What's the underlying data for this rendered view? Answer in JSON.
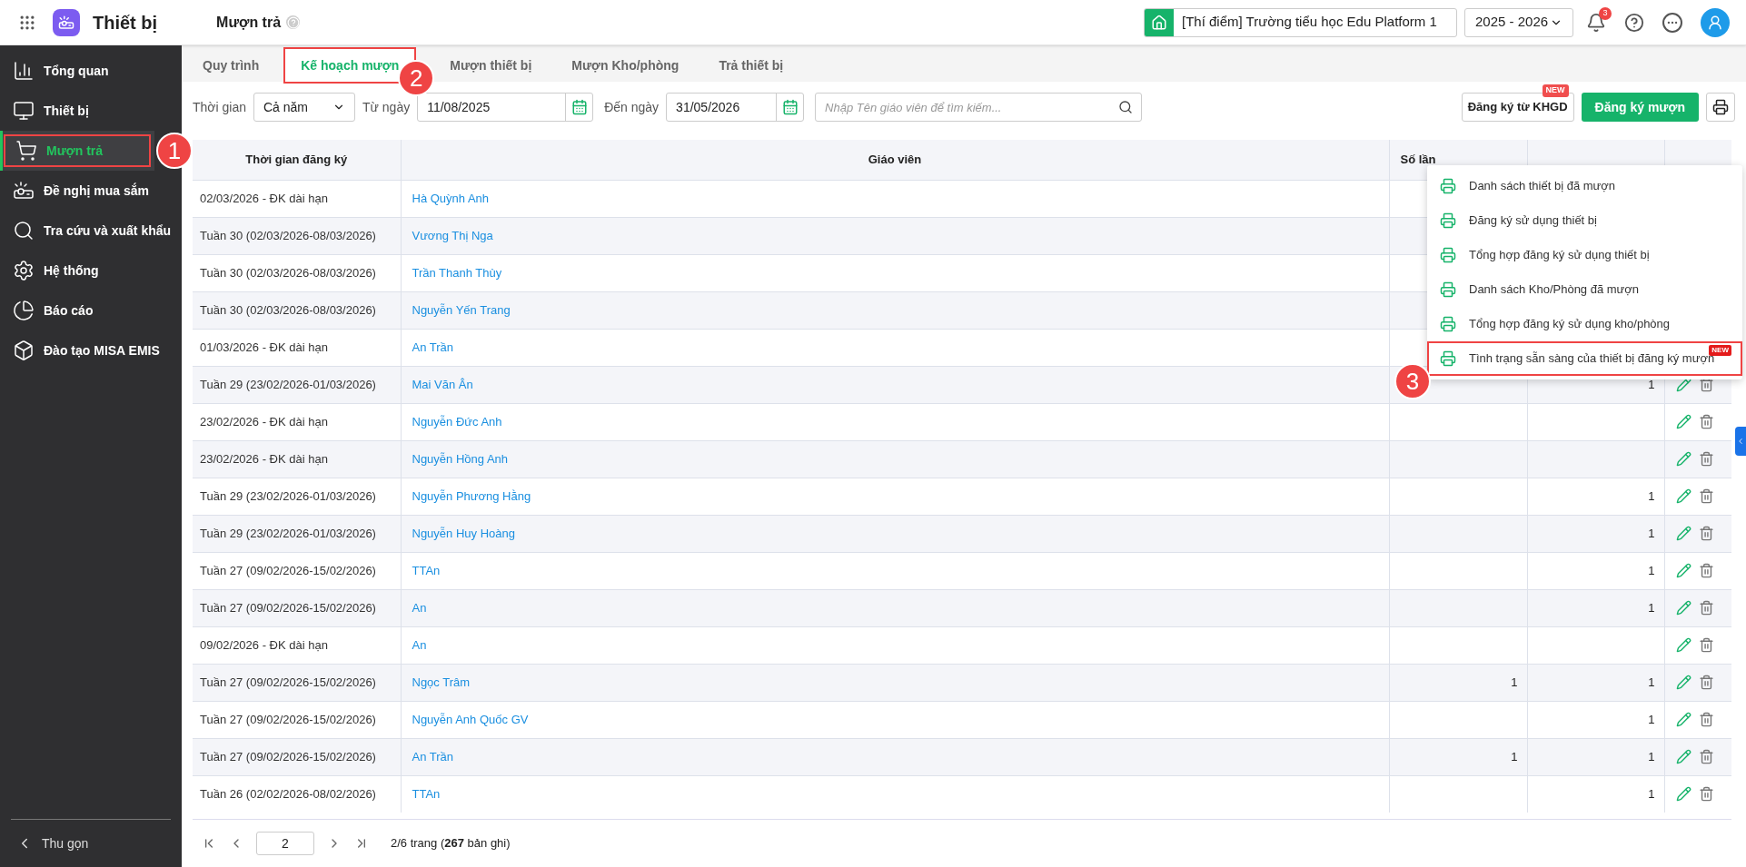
{
  "app": {
    "title": "Thiết bị"
  },
  "page": {
    "title": "Mượn trả"
  },
  "header": {
    "school": "[Thí điểm] Trường tiểu học Edu Platform 1",
    "year": "2025 - 2026",
    "notification_count": "3"
  },
  "sidebar": {
    "items": [
      {
        "kind": "overview",
        "label": "Tổng quan",
        "selected": false
      },
      {
        "kind": "device",
        "label": "Thiết bị",
        "selected": false
      },
      {
        "kind": "borrow",
        "label": "Mượn trả",
        "selected": true,
        "annotation": "1"
      },
      {
        "kind": "purchase",
        "label": "Đề nghị mua sắm",
        "selected": false
      },
      {
        "kind": "lookup",
        "label": "Tra cứu và xuất khẩu",
        "selected": false
      },
      {
        "kind": "system",
        "label": "Hệ thống",
        "selected": false
      },
      {
        "kind": "report",
        "label": "Báo cáo",
        "selected": false
      },
      {
        "kind": "training",
        "label": "Đào tạo MISA EMIS",
        "selected": false
      }
    ],
    "collapse": "Thu gọn"
  },
  "tabs": [
    {
      "label": "Quy trình",
      "selected": false
    },
    {
      "label": "Kế hoạch mượn",
      "selected": true,
      "annotation": "2"
    },
    {
      "label": "Mượn thiết bị",
      "selected": false
    },
    {
      "label": "Mượn Kho/phòng",
      "selected": false
    },
    {
      "label": "Trả thiết bị",
      "selected": false
    }
  ],
  "filters": {
    "period_label": "Thời gian",
    "period": "Cả năm",
    "from_label": "Từ ngày",
    "from": "11/08/2025",
    "to_label": "Đến ngày",
    "to": "31/05/2026",
    "search_placeholder": "Nhập Tên giáo viên để tìm kiếm..."
  },
  "actions": {
    "import_button": "Đăng ký từ KHGD",
    "import_badge": "NEW",
    "register_button": "Đăng ký mượn"
  },
  "print_menu": {
    "items": [
      {
        "label": "Danh sách thiết bị đã mượn"
      },
      {
        "label": "Đăng ký sử dụng thiết bị"
      },
      {
        "label": "Tổng hợp đăng ký sử dụng thiết bị"
      },
      {
        "label": "Danh sách Kho/Phòng đã mượn"
      },
      {
        "label": "Tổng hợp đăng ký sử dụng kho/phòng"
      },
      {
        "label": "Tình trạng sẵn sàng của thiết bị đăng ký mượn",
        "badge": "NEW",
        "annotation": "3"
      }
    ]
  },
  "table": {
    "columns": [
      "Thời gian đăng ký",
      "Giáo viên",
      "Số lần"
    ],
    "rows": [
      {
        "time": "02/03/2026 - ĐK dài hạn",
        "teacher": "Hà Quỳnh Anh"
      },
      {
        "time": "Tuần 30 (02/03/2026-08/03/2026)",
        "teacher": "Vương Thị Nga"
      },
      {
        "time": "Tuần 30 (02/03/2026-08/03/2026)",
        "teacher": "Trần Thanh Thùy"
      },
      {
        "time": "Tuần 30 (02/03/2026-08/03/2026)",
        "teacher": "Nguyễn Yến Trang"
      },
      {
        "time": "01/03/2026 - ĐK dài hạn",
        "teacher": "An Trần"
      },
      {
        "time": "Tuần 29 (23/02/2026-01/03/2026)",
        "teacher": "Mai Văn Ân",
        "column_4": "1"
      },
      {
        "time": "23/02/2026 - ĐK dài hạn",
        "teacher": "Nguyễn Đức Anh"
      },
      {
        "time": "23/02/2026 - ĐK dài hạn",
        "teacher": "Nguyễn Hồng Anh"
      },
      {
        "time": "Tuần 29 (23/02/2026-01/03/2026)",
        "teacher": "Nguyễn Phương Hằng",
        "column_4": "1"
      },
      {
        "time": "Tuần 29 (23/02/2026-01/03/2026)",
        "teacher": "Nguyễn Huy Hoàng",
        "column_4": "1"
      },
      {
        "time": "Tuần 27 (09/02/2026-15/02/2026)",
        "teacher": "TTAn",
        "column_4": "1"
      },
      {
        "time": "Tuần 27 (09/02/2026-15/02/2026)",
        "teacher": "An",
        "column_4": "1"
      },
      {
        "time": "09/02/2026 - ĐK dài hạn",
        "teacher": "An"
      },
      {
        "time": "Tuần 27 (09/02/2026-15/02/2026)",
        "teacher": "Ngọc Trâm",
        "column_3": "1",
        "column_4": "1"
      },
      {
        "time": "Tuần 27 (09/02/2026-15/02/2026)",
        "teacher": "Nguyễn Anh Quốc GV",
        "column_4": "1"
      },
      {
        "time": "Tuần 27 (09/02/2026-15/02/2026)",
        "teacher": "An Trần",
        "column_3": "1",
        "column_4": "1"
      },
      {
        "time": "Tuần 26 (02/02/2026-08/02/2026)",
        "teacher": "TTAn",
        "column_4": "1"
      }
    ]
  },
  "pagination": {
    "page": "2",
    "summary": "2/6 trang (**267** bản ghi)"
  }
}
